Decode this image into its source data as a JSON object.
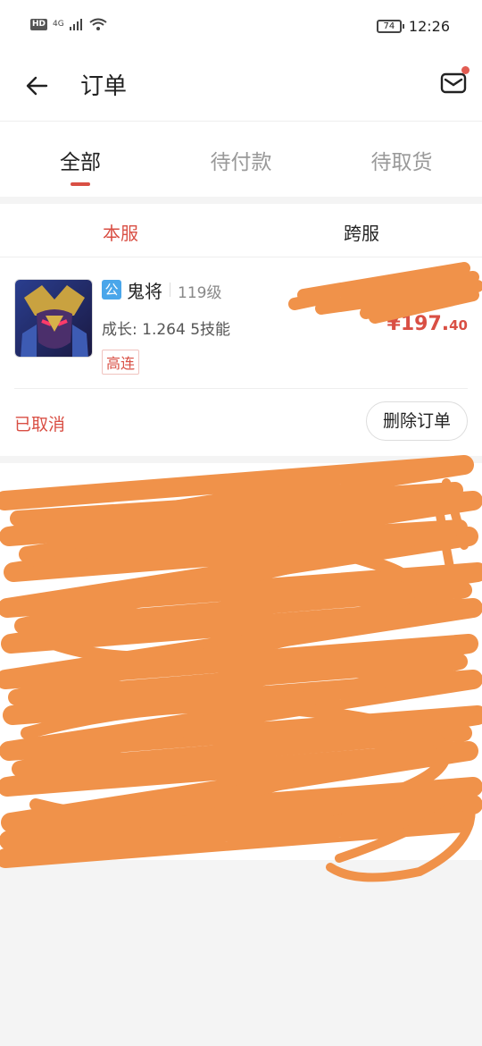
{
  "status_bar": {
    "hd": "HD",
    "network": "4G",
    "battery": "74",
    "time": "12:26"
  },
  "header": {
    "title": "订单",
    "back_icon": "arrow-left-icon",
    "mail_icon": "mail-icon"
  },
  "tabs": [
    {
      "label": "全部",
      "active": true
    },
    {
      "label": "待付款",
      "active": false
    },
    {
      "label": "待取货",
      "active": false
    }
  ],
  "subtabs": [
    {
      "label": "本服",
      "active": true
    },
    {
      "label": "跨服",
      "active": false
    }
  ],
  "orders": [
    {
      "badge": "公",
      "name": "鬼将",
      "level": "119级",
      "growth": "成长: 1.264  5技能",
      "tag": "高连",
      "price_main": "¥197.",
      "price_decimal": "40",
      "status": "已取消",
      "action": "删除订单"
    }
  ],
  "colors": {
    "accent": "#d94f44",
    "scribble": "#f0924a",
    "badge_blue": "#4aa6ea"
  }
}
